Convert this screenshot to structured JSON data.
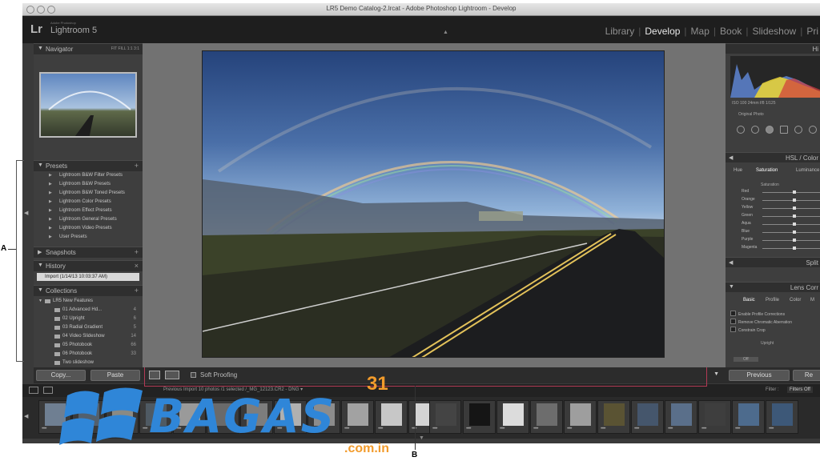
{
  "window": {
    "title": "LR5 Demo Catalog-2.lrcat - Adobe Photoshop Lightroom - Develop"
  },
  "app": {
    "logo": "Lr",
    "small": "Adobe Photoshop",
    "name": "Lightroom 5"
  },
  "modules": [
    "Library",
    "Develop",
    "Map",
    "Book",
    "Slideshow",
    "Pri"
  ],
  "left": {
    "navigator": {
      "title": "Navigator",
      "zoom": "FIT  FILL  1:1  3:1"
    },
    "presets": {
      "title": "Presets",
      "items": [
        "Lightroom B&W Filter Presets",
        "Lightroom B&W Presets",
        "Lightroom B&W Toned Presets",
        "Lightroom Color Presets",
        "Lightroom Effect Presets",
        "Lightroom General Presets",
        "Lightroom Video Presets",
        "User Presets"
      ]
    },
    "snapshots": {
      "title": "Snapshots"
    },
    "history": {
      "title": "History",
      "entry": "Import (1/14/13 10:03:37 AM)"
    },
    "collections": {
      "title": "Collections",
      "root": "LR5 New Features",
      "items": [
        {
          "name": "01 Advanced Hd...",
          "count": "4"
        },
        {
          "name": "02 Upright",
          "count": "6"
        },
        {
          "name": "03 Radial Gradient",
          "count": "5"
        },
        {
          "name": "04 Video Slideshow",
          "count": "14"
        },
        {
          "name": "05 Photobook",
          "count": "66"
        },
        {
          "name": "06 Photobook",
          "count": "33"
        },
        {
          "name": "Two slideshow",
          "count": ""
        }
      ]
    },
    "copy_label": "Copy...",
    "paste_label": "Paste"
  },
  "toolbar": {
    "soft_proofing": "Soft Proofing"
  },
  "right": {
    "histogram": {
      "title": "Hi",
      "stats": "ISO 100   24mm   f/8   1/125",
      "original": "Original Photo"
    },
    "hsl": {
      "title": "HSL / Color",
      "tabs": [
        "Hue",
        "Saturation",
        "Luminance"
      ],
      "section": "Saturation",
      "sliders": [
        "Red",
        "Orange",
        "Yellow",
        "Green",
        "Aqua",
        "Blue",
        "Purple",
        "Magenta"
      ]
    },
    "split": {
      "title": "Split"
    },
    "lens": {
      "title": "Lens Corr",
      "tabs": [
        "Basic",
        "Profile",
        "Color",
        "M"
      ],
      "checks": [
        "Enable Profile Corrections",
        "Remove Chromatic Aberration",
        "Constrain Crop"
      ],
      "upright": "Upright",
      "off": "Off"
    },
    "previous_label": "Previous",
    "reset_label": "Re"
  },
  "filmstrip": {
    "path": "Previous Import   10 photos /1 selected /_MG_12123.CR2 - DNG ▾",
    "filter": "Filter :",
    "filters_off": "Filters Off"
  },
  "annotations": {
    "a": "A",
    "b": "B"
  },
  "watermark": {
    "text": "BAGAS",
    "num": "31",
    "domain": ".com.in"
  },
  "colors": {
    "accent": "#2f86d8",
    "watermark_orange": "#f29b2b",
    "annotation": "#b23a55"
  }
}
